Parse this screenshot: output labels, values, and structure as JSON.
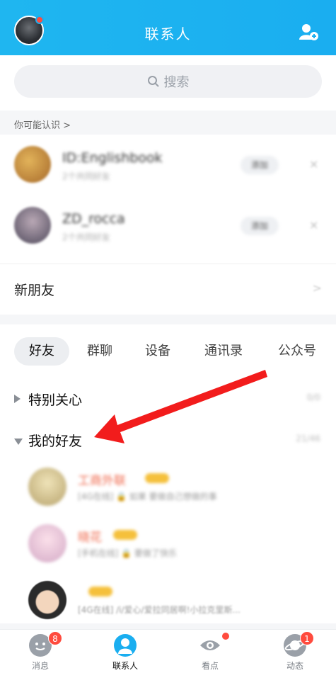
{
  "header": {
    "title": "联系人",
    "accent": "#1aaef0"
  },
  "search": {
    "placeholder": "搜索"
  },
  "recommend": {
    "label": "你可能认识 >",
    "items": [
      {
        "name": "ID:Englishbook",
        "sub": "2个共同好友",
        "action": "添加",
        "avatar_color": "#c8953a"
      },
      {
        "name": "ZD_rocca",
        "sub": "2个共同好友",
        "action": "添加",
        "avatar_color": "#6f6a7a"
      }
    ]
  },
  "new_friends": {
    "label": "新朋友",
    "arrow": ">"
  },
  "tabs": [
    {
      "label": "好友",
      "active": true
    },
    {
      "label": "群聊",
      "active": false
    },
    {
      "label": "设备",
      "active": false
    },
    {
      "label": "通讯录",
      "active": false
    },
    {
      "label": "公众号",
      "active": false
    }
  ],
  "groups": [
    {
      "label": "特别关心",
      "count": "0/0",
      "expanded": false
    },
    {
      "label": "我的好友",
      "count": "21/46",
      "expanded": true
    }
  ],
  "friends": [
    {
      "name": "工商外联",
      "sub": "[4G在线] 🔒 如果 要做自己想做的事",
      "avatar_color": "#d9c89a",
      "vip": true
    },
    {
      "name": "晓花",
      "sub": "[手机在线] 🔒 要做了快乐",
      "avatar_color": "#e8c8d8",
      "vip": true
    },
    {
      "name": "",
      "sub": "[4G在线] /i/爱心/爱拉同居啊!小拉克里斯...",
      "avatar_color": "#3a3a3a",
      "vip": true
    }
  ],
  "bottom_nav": [
    {
      "label": "消息",
      "badge": "8",
      "icon": "chat-icon",
      "active": false
    },
    {
      "label": "联系人",
      "badge": "",
      "icon": "contacts-icon",
      "active": true
    },
    {
      "label": "看点",
      "badge": "dot",
      "icon": "eye-icon",
      "active": false
    },
    {
      "label": "动态",
      "badge": "1",
      "icon": "planet-icon",
      "active": false
    }
  ]
}
